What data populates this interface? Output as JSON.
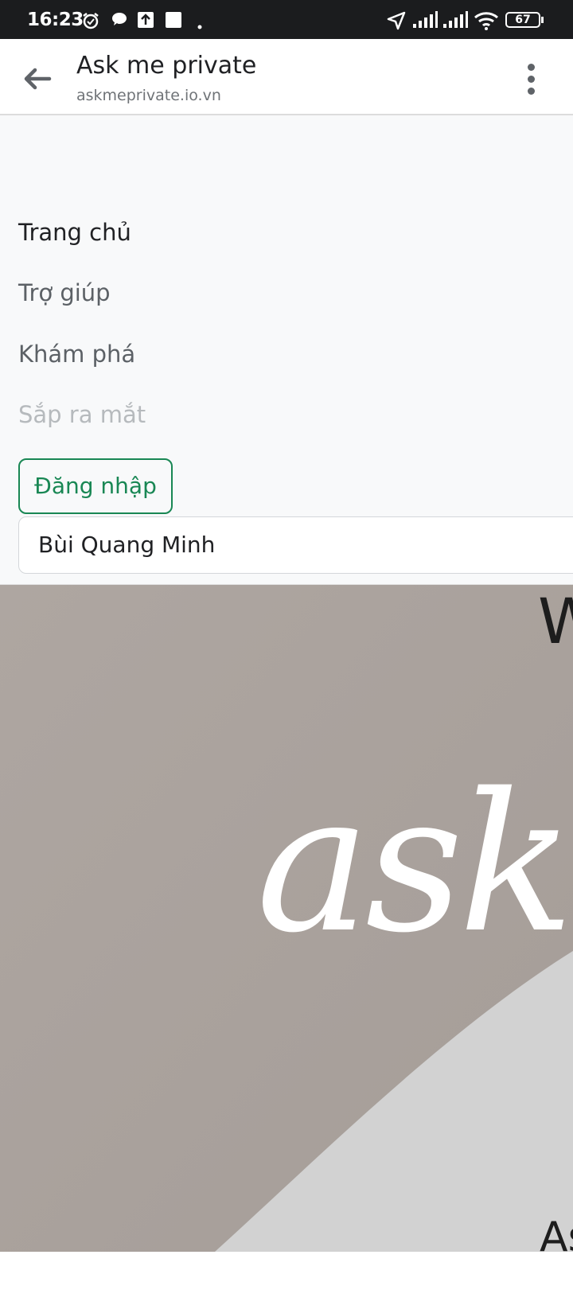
{
  "status_bar": {
    "time": "16:23",
    "battery": "67",
    "icons": [
      "alarm-icon",
      "chat-bubble-icon",
      "upload-icon",
      "app-square-icon",
      "dot-icon",
      "location-arrow-icon",
      "signal-icon",
      "signal-icon",
      "wifi-icon",
      "battery-icon"
    ]
  },
  "header": {
    "title": "Ask me private",
    "url": "askmeprivate.io.vn",
    "back_icon": "arrow-left-icon",
    "menu_icon": "more-vertical-icon"
  },
  "nav": {
    "items": [
      {
        "label": "Trang chủ",
        "state": "active"
      },
      {
        "label": "Trợ giúp",
        "state": "normal"
      },
      {
        "label": "Khám phá",
        "state": "normal"
      },
      {
        "label": "Sắp ra mắt",
        "state": "disabled"
      }
    ],
    "login_label": "Đăng nhập",
    "user_name": "Bùi Quang Minh"
  },
  "hero": {
    "top_text": "W",
    "script_text": "ask",
    "bottom_text": "As"
  },
  "colors": {
    "accent": "#198754",
    "hero_bg": "#aca49f",
    "status_bar": "#1b1c1e"
  }
}
